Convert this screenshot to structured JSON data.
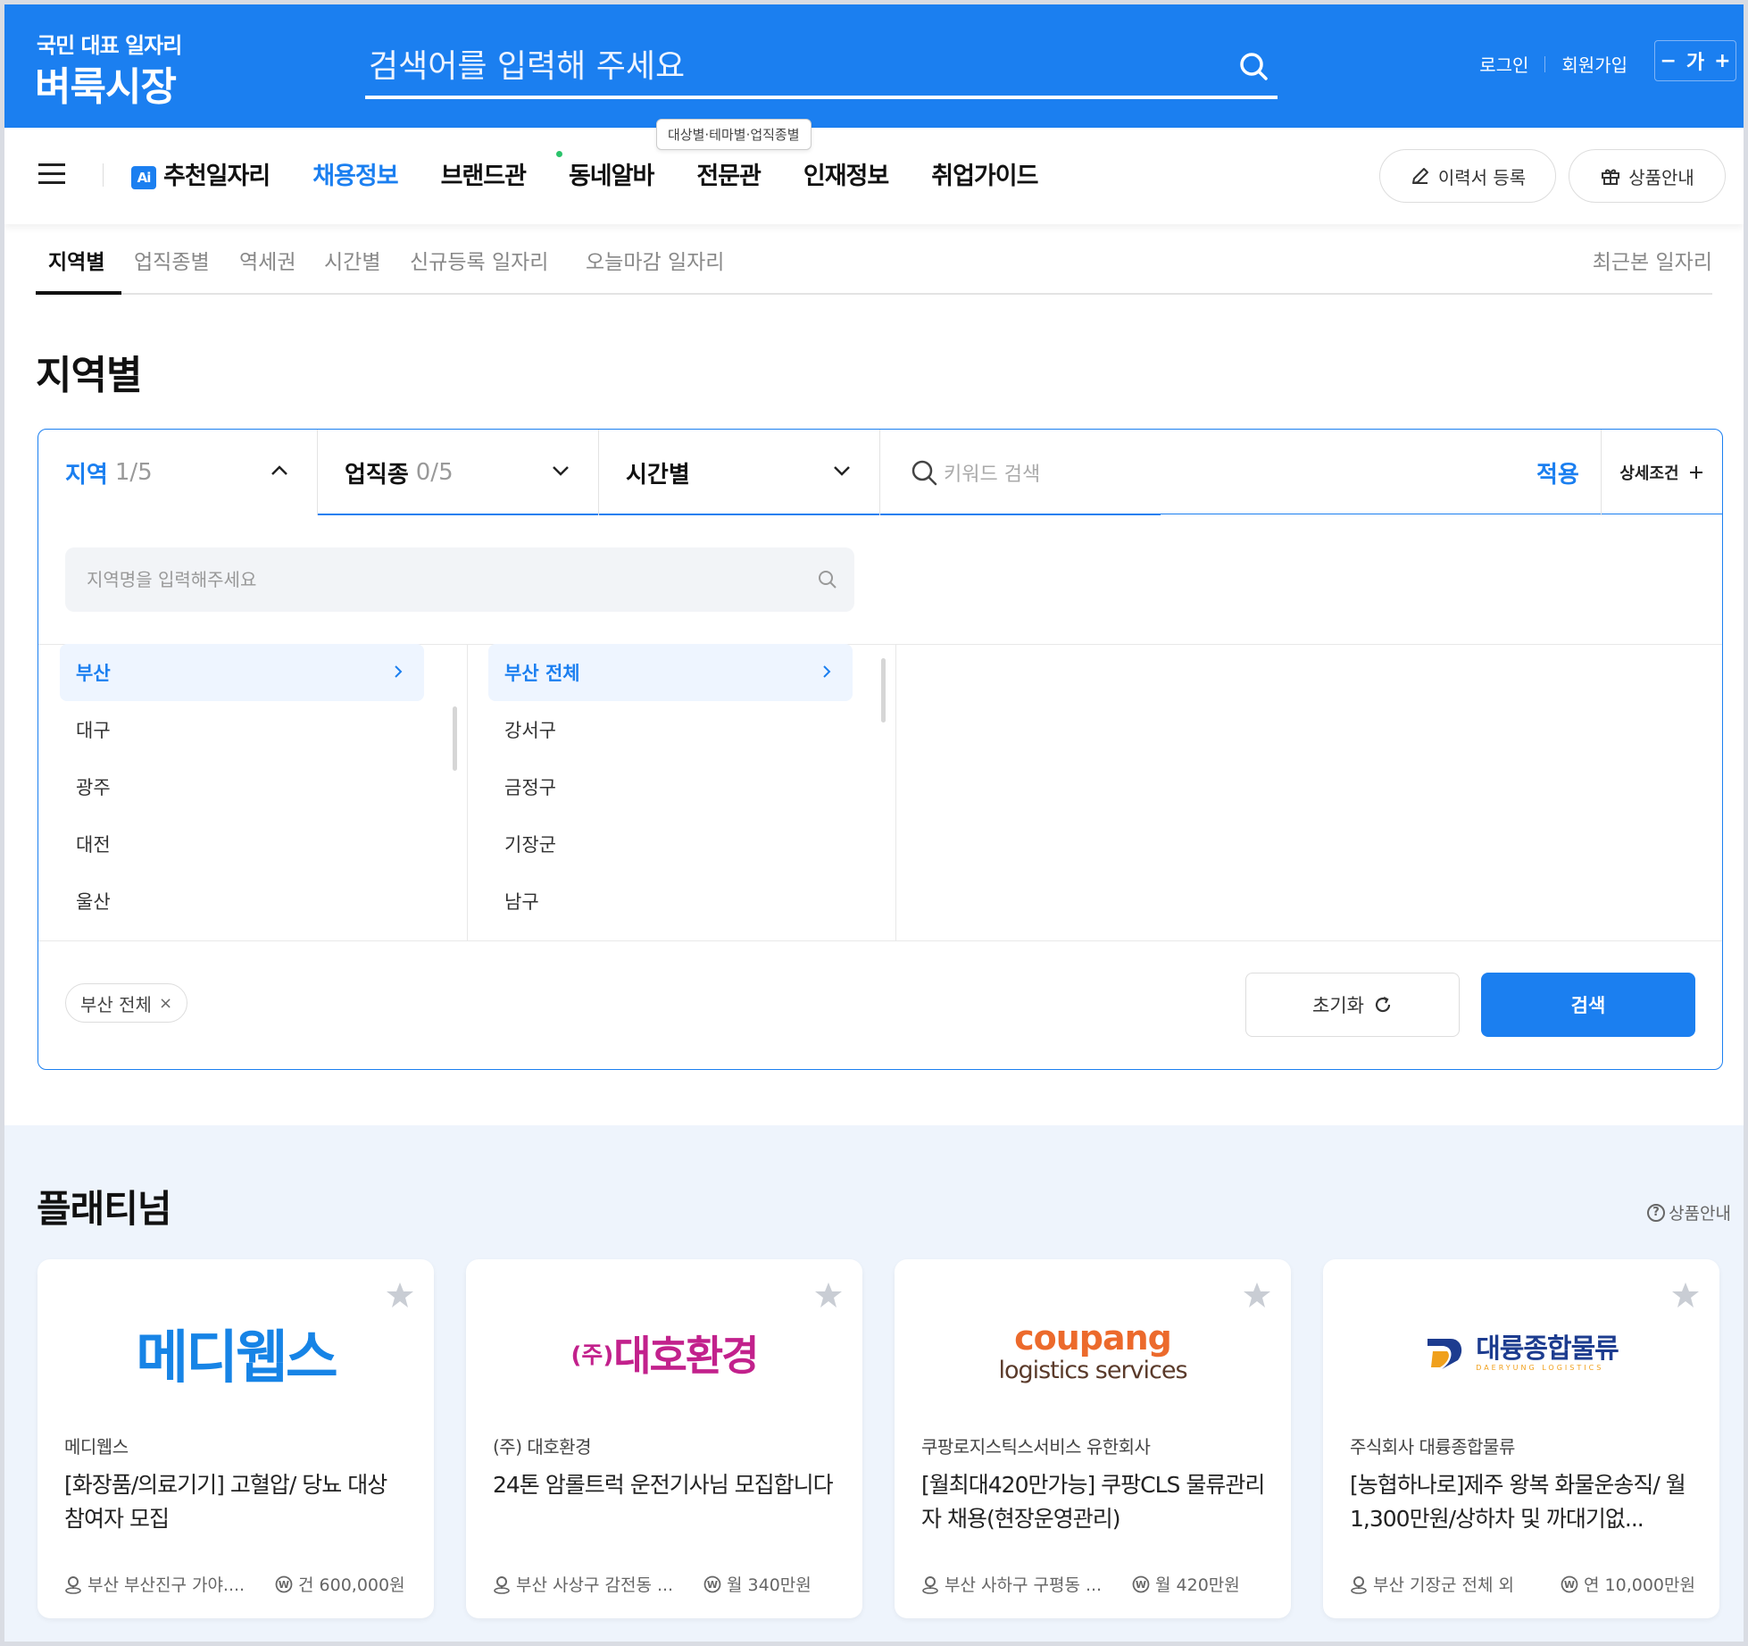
{
  "header": {
    "logo_sub": "국민 대표 일자리",
    "logo_main": "벼룩시장",
    "search_placeholder": "검색어를 입력해 주세요",
    "login": "로그인",
    "signup": "회원가입",
    "font_minus": "−",
    "font_label": "가",
    "font_plus": "+"
  },
  "gnb": {
    "ai_badge": "Ai",
    "items": [
      "추천일자리",
      "채용정보",
      "브랜드관",
      "동네알바",
      "전문관",
      "인재정보",
      "취업가이드"
    ],
    "tooltip": "대상별·테마별·업직종별",
    "resume_btn": "이력서 등록",
    "product_btn": "상품안내"
  },
  "subtabs": {
    "items": [
      "지역별",
      "업직종별",
      "역세권",
      "시간별",
      "신규등록 일자리",
      "오늘마감 일자리"
    ],
    "recent": "최근본 일자리"
  },
  "page_title": "지역별",
  "filter": {
    "tabs": [
      {
        "label": "지역",
        "count": "1/5"
      },
      {
        "label": "업직종",
        "count": "0/5"
      },
      {
        "label": "시간별",
        "count": ""
      }
    ],
    "keyword_placeholder": "키워드 검색",
    "apply": "적용",
    "detail": "상세조건",
    "region_placeholder": "지역명을 입력해주세요",
    "col1": [
      "부산",
      "대구",
      "광주",
      "대전",
      "울산"
    ],
    "col2": [
      "부산 전체",
      "강서구",
      "금정구",
      "기장군",
      "남구"
    ],
    "chip": "부산 전체",
    "chip_remove": "×",
    "reset": "초기화",
    "search": "검색"
  },
  "platinum": {
    "title": "플래티넘",
    "info": "상품안내",
    "cards": [
      {
        "logo": "메디웹스",
        "company": "메디웹스",
        "title": "[화장품/의료기기] 고혈압/ 당뇨 대상 참여자 모집",
        "location": "부산 부산진구 가야....",
        "pay": "건 600,000원"
      },
      {
        "logo_prefix": "(주)",
        "logo": "대호환경",
        "company": "(주) 대호환경",
        "title": "24톤 암롤트럭 운전기사님 모집합니다",
        "location": "부산 사상구 감전동 ...",
        "pay": "월 340만원"
      },
      {
        "logo_top": "coupang",
        "logo": "logistics services",
        "company": "쿠팡로지스틱스서비스 유한회사",
        "title": "[월최대420만가능] 쿠팡CLS 물류관리자 채용(현장운영관리)",
        "location": "부산 사하구 구평동 ...",
        "pay": "월 420만원"
      },
      {
        "logo": "대륭종합물류",
        "logo_sub": "DAERYUNG LOGISTICS",
        "company": "주식회사 대륭종합물류",
        "title": "[농협하나로]제주 왕복 화물운송직/ 월1,300만원/상하차 및 까대기없...",
        "location": "부산 기장군 전체 외",
        "pay": "연 10,000만원"
      }
    ]
  },
  "colors": {
    "brand": "#1b7ff0",
    "medi": "#1784e6",
    "daeho": "#c2218c",
    "coupang_orange": "#ec6a2c",
    "daeryung_navy": "#1d3c8f"
  }
}
